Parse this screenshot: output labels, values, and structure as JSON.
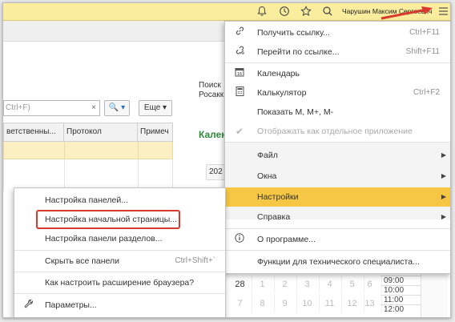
{
  "topbar": {
    "user_name": "Чарушин Максим Сергеевич",
    "icons": [
      "bell-icon",
      "history-icon",
      "star-icon",
      "search-icon",
      "hamburger-menu-icon"
    ],
    "background": "#fbed9e",
    "arrow_color": "#d83b2e"
  },
  "background_page": {
    "search_placeholder": "Ctrl+F)",
    "clear_label": "×",
    "find_label": "🔍 ▾",
    "more_label": "Еще ▾",
    "grid_columns": [
      "ветственны...",
      "Протокол",
      "Примеч"
    ],
    "poisk_line1": "Поиск",
    "poisk_line2": "Росакк",
    "calendar_title": "Кален",
    "year_label": "202",
    "calendar_row1": [
      "28",
      "1",
      "2",
      "3",
      "4",
      "5",
      "6"
    ],
    "calendar_row2": [
      "7",
      "8",
      "9",
      "10",
      "11",
      "12",
      "13"
    ],
    "times": [
      "09:00",
      "10:00",
      "11:00",
      "12:00"
    ]
  },
  "main_menu": {
    "highlight_color": "#f6c744",
    "items": [
      {
        "icon": "link-icon",
        "label": "Получить ссылку...",
        "shortcut": "Ctrl+F11"
      },
      {
        "icon": "goto-link-icon",
        "label": "Перейти по ссылке...",
        "shortcut": "Shift+F11"
      },
      {
        "icon": "calendar-icon",
        "label": "Календарь",
        "shortcut": ""
      },
      {
        "icon": "calculator-icon",
        "label": "Калькулятор",
        "shortcut": "Ctrl+F2"
      },
      {
        "icon": "",
        "label": "Показать M, M+, M-",
        "shortcut": ""
      },
      {
        "icon": "check-icon",
        "label": "Отображать как отдельное приложение",
        "shortcut": ""
      },
      {
        "icon": "",
        "label": "Файл",
        "shortcut": ""
      },
      {
        "icon": "",
        "label": "Окна",
        "shortcut": ""
      },
      {
        "icon": "",
        "label": "Настройки",
        "shortcut": ""
      },
      {
        "icon": "",
        "label": "Справка",
        "shortcut": ""
      },
      {
        "icon": "info-icon",
        "label": "О программе...",
        "shortcut": ""
      },
      {
        "icon": "",
        "label": "Функции для технического специалиста...",
        "shortcut": ""
      }
    ]
  },
  "settings_submenu": {
    "items": [
      {
        "label": "Настройка панелей...",
        "shortcut": ""
      },
      {
        "label": "Настройка начальной страницы...",
        "shortcut": ""
      },
      {
        "label": "Настройка панели разделов...",
        "shortcut": ""
      },
      {
        "label": "Скрыть все панели",
        "shortcut": "Ctrl+Shift+`"
      },
      {
        "label": "Как настроить расширение браузера?",
        "shortcut": ""
      },
      {
        "icon": "wrench-icon",
        "label": "Параметры...",
        "shortcut": ""
      }
    ]
  }
}
